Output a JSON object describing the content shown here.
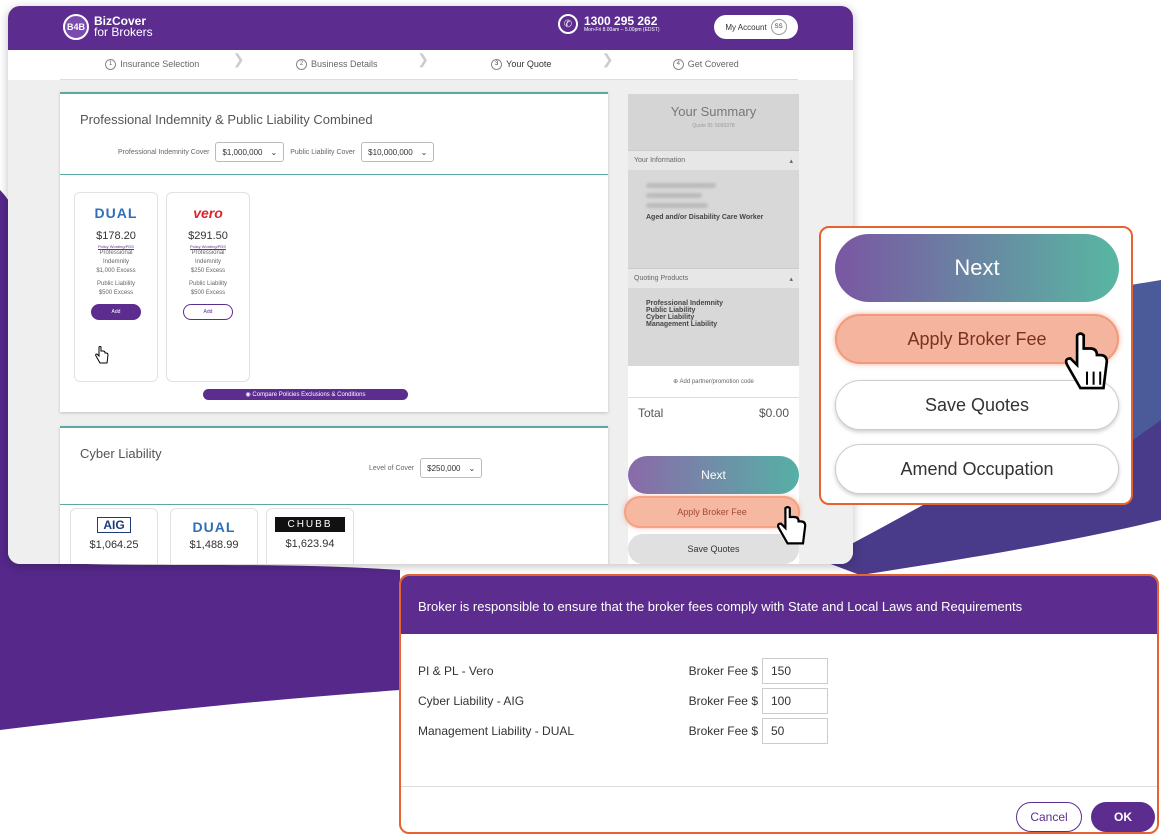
{
  "colors": {
    "brand": "#5c2d8f",
    "accent_orange": "#e4632f",
    "teal": "#56b0a6",
    "fee_btn": "#f5b49d"
  },
  "logo": {
    "badge": "B4B",
    "name": "BizCover",
    "sub": "for Brokers"
  },
  "header": {
    "phone": "1300 295 262",
    "hours": "Mon-Fri 8.00am – 5.00pm (EDST)",
    "account_label": "My Account",
    "avatar": "SS",
    "phone_icon": "phone-icon"
  },
  "steps": [
    {
      "num": "1",
      "label": "Insurance Selection"
    },
    {
      "num": "2",
      "label": "Business Details"
    },
    {
      "num": "3",
      "label": "Your Quote"
    },
    {
      "num": "4",
      "label": "Get Covered"
    }
  ],
  "pipl": {
    "title": "Professional Indemnity & Public Liability Combined",
    "pi_label": "Professional Indemnity Cover",
    "pi_value": "$1,000,000",
    "pl_label": "Public Liability Cover",
    "pl_value": "$10,000,000",
    "products": [
      {
        "brand": "DUAL",
        "price": "$178.20",
        "wording": "Policy Wording/PDS",
        "l1": "Professional",
        "l2": "Indemnity",
        "l3": "$1,000 Excess",
        "l4": "Public Liability",
        "l5": "$500 Excess",
        "add": "Add"
      },
      {
        "brand": "vero",
        "price": "$291.50",
        "wording": "Policy Wording/PDS",
        "l1": "Professional",
        "l2": "Indemnity",
        "l3": "$250 Excess",
        "l4": "Public Liability",
        "l5": "$500 Excess",
        "add": "Add"
      }
    ],
    "compare": "Compare Policies Exclusions & Conditions"
  },
  "cyber": {
    "title": "Cyber Liability",
    "level_label": "Level of Cover",
    "level_value": "$250,000",
    "products": [
      {
        "brand": "AIG",
        "price": "$1,064.25"
      },
      {
        "brand": "DUAL",
        "price": "$1,488.99"
      },
      {
        "brand": "CHUBB",
        "price": "$1,623.94"
      }
    ]
  },
  "summary": {
    "title": "Your Summary",
    "quote_id": "Quote ID: 5093378",
    "info_label": "Your Information",
    "occupation": "Aged and/or Disability Care Worker",
    "products_label": "Quoting Products",
    "products": [
      "Professional Indemnity",
      "Public Liability",
      "Cyber Liability",
      "Management Liability"
    ],
    "promo": "Add partner/promotion code",
    "total_label": "Total",
    "total_value": "$0.00",
    "next": "Next",
    "apply_fee": "Apply Broker Fee",
    "save": "Save Quotes"
  },
  "zoom": {
    "next": "Next",
    "apply_fee": "Apply Broker Fee",
    "save": "Save Quotes",
    "amend": "Amend Occupation"
  },
  "modal": {
    "header": "Broker is responsible to ensure that the broker fees comply with State and Local Laws and Requirements",
    "rows": [
      {
        "label": "PI & PL - Vero",
        "fee_label": "Broker Fee $",
        "fee": "150"
      },
      {
        "label": "Cyber Liability - AIG",
        "fee_label": "Broker Fee $",
        "fee": "100"
      },
      {
        "label": "Management Liability - DUAL",
        "fee_label": "Broker Fee $",
        "fee": "50"
      }
    ],
    "cancel": "Cancel",
    "ok": "OK"
  }
}
